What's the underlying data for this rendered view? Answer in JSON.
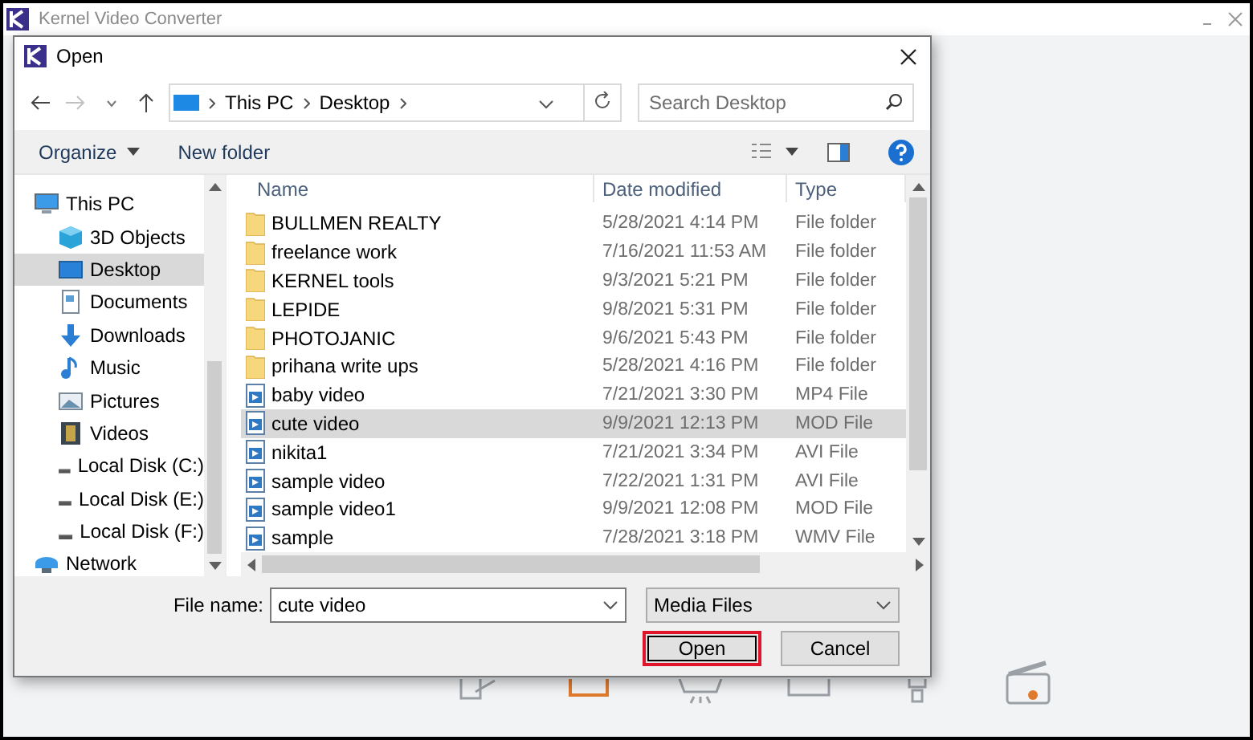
{
  "app": {
    "title": "Kernel Video Converter"
  },
  "dialog": {
    "title": "Open",
    "path": [
      "This PC",
      "Desktop"
    ],
    "search": {
      "placeholder": "Search Desktop"
    },
    "toolbar": [
      {
        "label": "Organize",
        "dropdown": true
      },
      {
        "label": "New folder",
        "dropdown": false
      }
    ],
    "sidebar": [
      {
        "label": "This PC",
        "kind": "pc",
        "selected": false,
        "children": [
          {
            "label": "3D Objects",
            "kind": "cube",
            "selected": false
          },
          {
            "label": "Desktop",
            "kind": "desktop",
            "selected": true
          },
          {
            "label": "Documents",
            "kind": "document",
            "selected": false
          },
          {
            "label": "Downloads",
            "kind": "download",
            "selected": false
          },
          {
            "label": "Music",
            "kind": "music",
            "selected": false
          },
          {
            "label": "Pictures",
            "kind": "pictures",
            "selected": false
          },
          {
            "label": "Videos",
            "kind": "film",
            "selected": false
          },
          {
            "label": "Local Disk (C:)",
            "kind": "disk",
            "selected": false
          },
          {
            "label": "Local Disk (E:)",
            "kind": "disk",
            "selected": false
          },
          {
            "label": "Local Disk (F:)",
            "kind": "disk",
            "selected": false
          }
        ]
      },
      {
        "label": "Network",
        "kind": "network",
        "selected": false
      }
    ],
    "columns": [
      "Name",
      "Date modified",
      "Type"
    ],
    "files": [
      {
        "name": "BULLMEN REALTY",
        "modified": "5/28/2021 4:14 PM",
        "type": "File folder",
        "kind": "folder",
        "selected": false
      },
      {
        "name": "freelance work",
        "modified": "7/16/2021 11:53 AM",
        "type": "File folder",
        "kind": "folder",
        "selected": false
      },
      {
        "name": "KERNEL tools",
        "modified": "9/3/2021 5:21 PM",
        "type": "File folder",
        "kind": "folder",
        "selected": false
      },
      {
        "name": "LEPIDE",
        "modified": "9/8/2021 5:31 PM",
        "type": "File folder",
        "kind": "folder",
        "selected": false
      },
      {
        "name": "PHOTOJANIC",
        "modified": "9/6/2021 5:43 PM",
        "type": "File folder",
        "kind": "folder",
        "selected": false
      },
      {
        "name": "prihana write ups",
        "modified": "5/28/2021 4:16 PM",
        "type": "File folder",
        "kind": "folder",
        "selected": false
      },
      {
        "name": "baby video",
        "modified": "7/21/2021 3:30 PM",
        "type": "MP4 File",
        "kind": "video",
        "selected": false
      },
      {
        "name": "cute video",
        "modified": "9/9/2021 12:13 PM",
        "type": "MOD File",
        "kind": "video",
        "selected": true
      },
      {
        "name": "nikita1",
        "modified": "7/21/2021 3:34 PM",
        "type": "AVI File",
        "kind": "video",
        "selected": false
      },
      {
        "name": "sample video",
        "modified": "7/22/2021 1:31 PM",
        "type": "AVI File",
        "kind": "video",
        "selected": false
      },
      {
        "name": "sample video1",
        "modified": "9/9/2021 12:08 PM",
        "type": "MOD File",
        "kind": "video",
        "selected": false
      },
      {
        "name": "sample",
        "modified": "7/28/2021 3:18 PM",
        "type": "WMV File",
        "kind": "video",
        "selected": false
      }
    ],
    "file_name": {
      "label": "File name:",
      "value": "cute video"
    },
    "file_type": "Media Files",
    "buttons": [
      {
        "label": "Open",
        "focused": true
      },
      {
        "label": "Cancel",
        "focused": false
      }
    ]
  }
}
